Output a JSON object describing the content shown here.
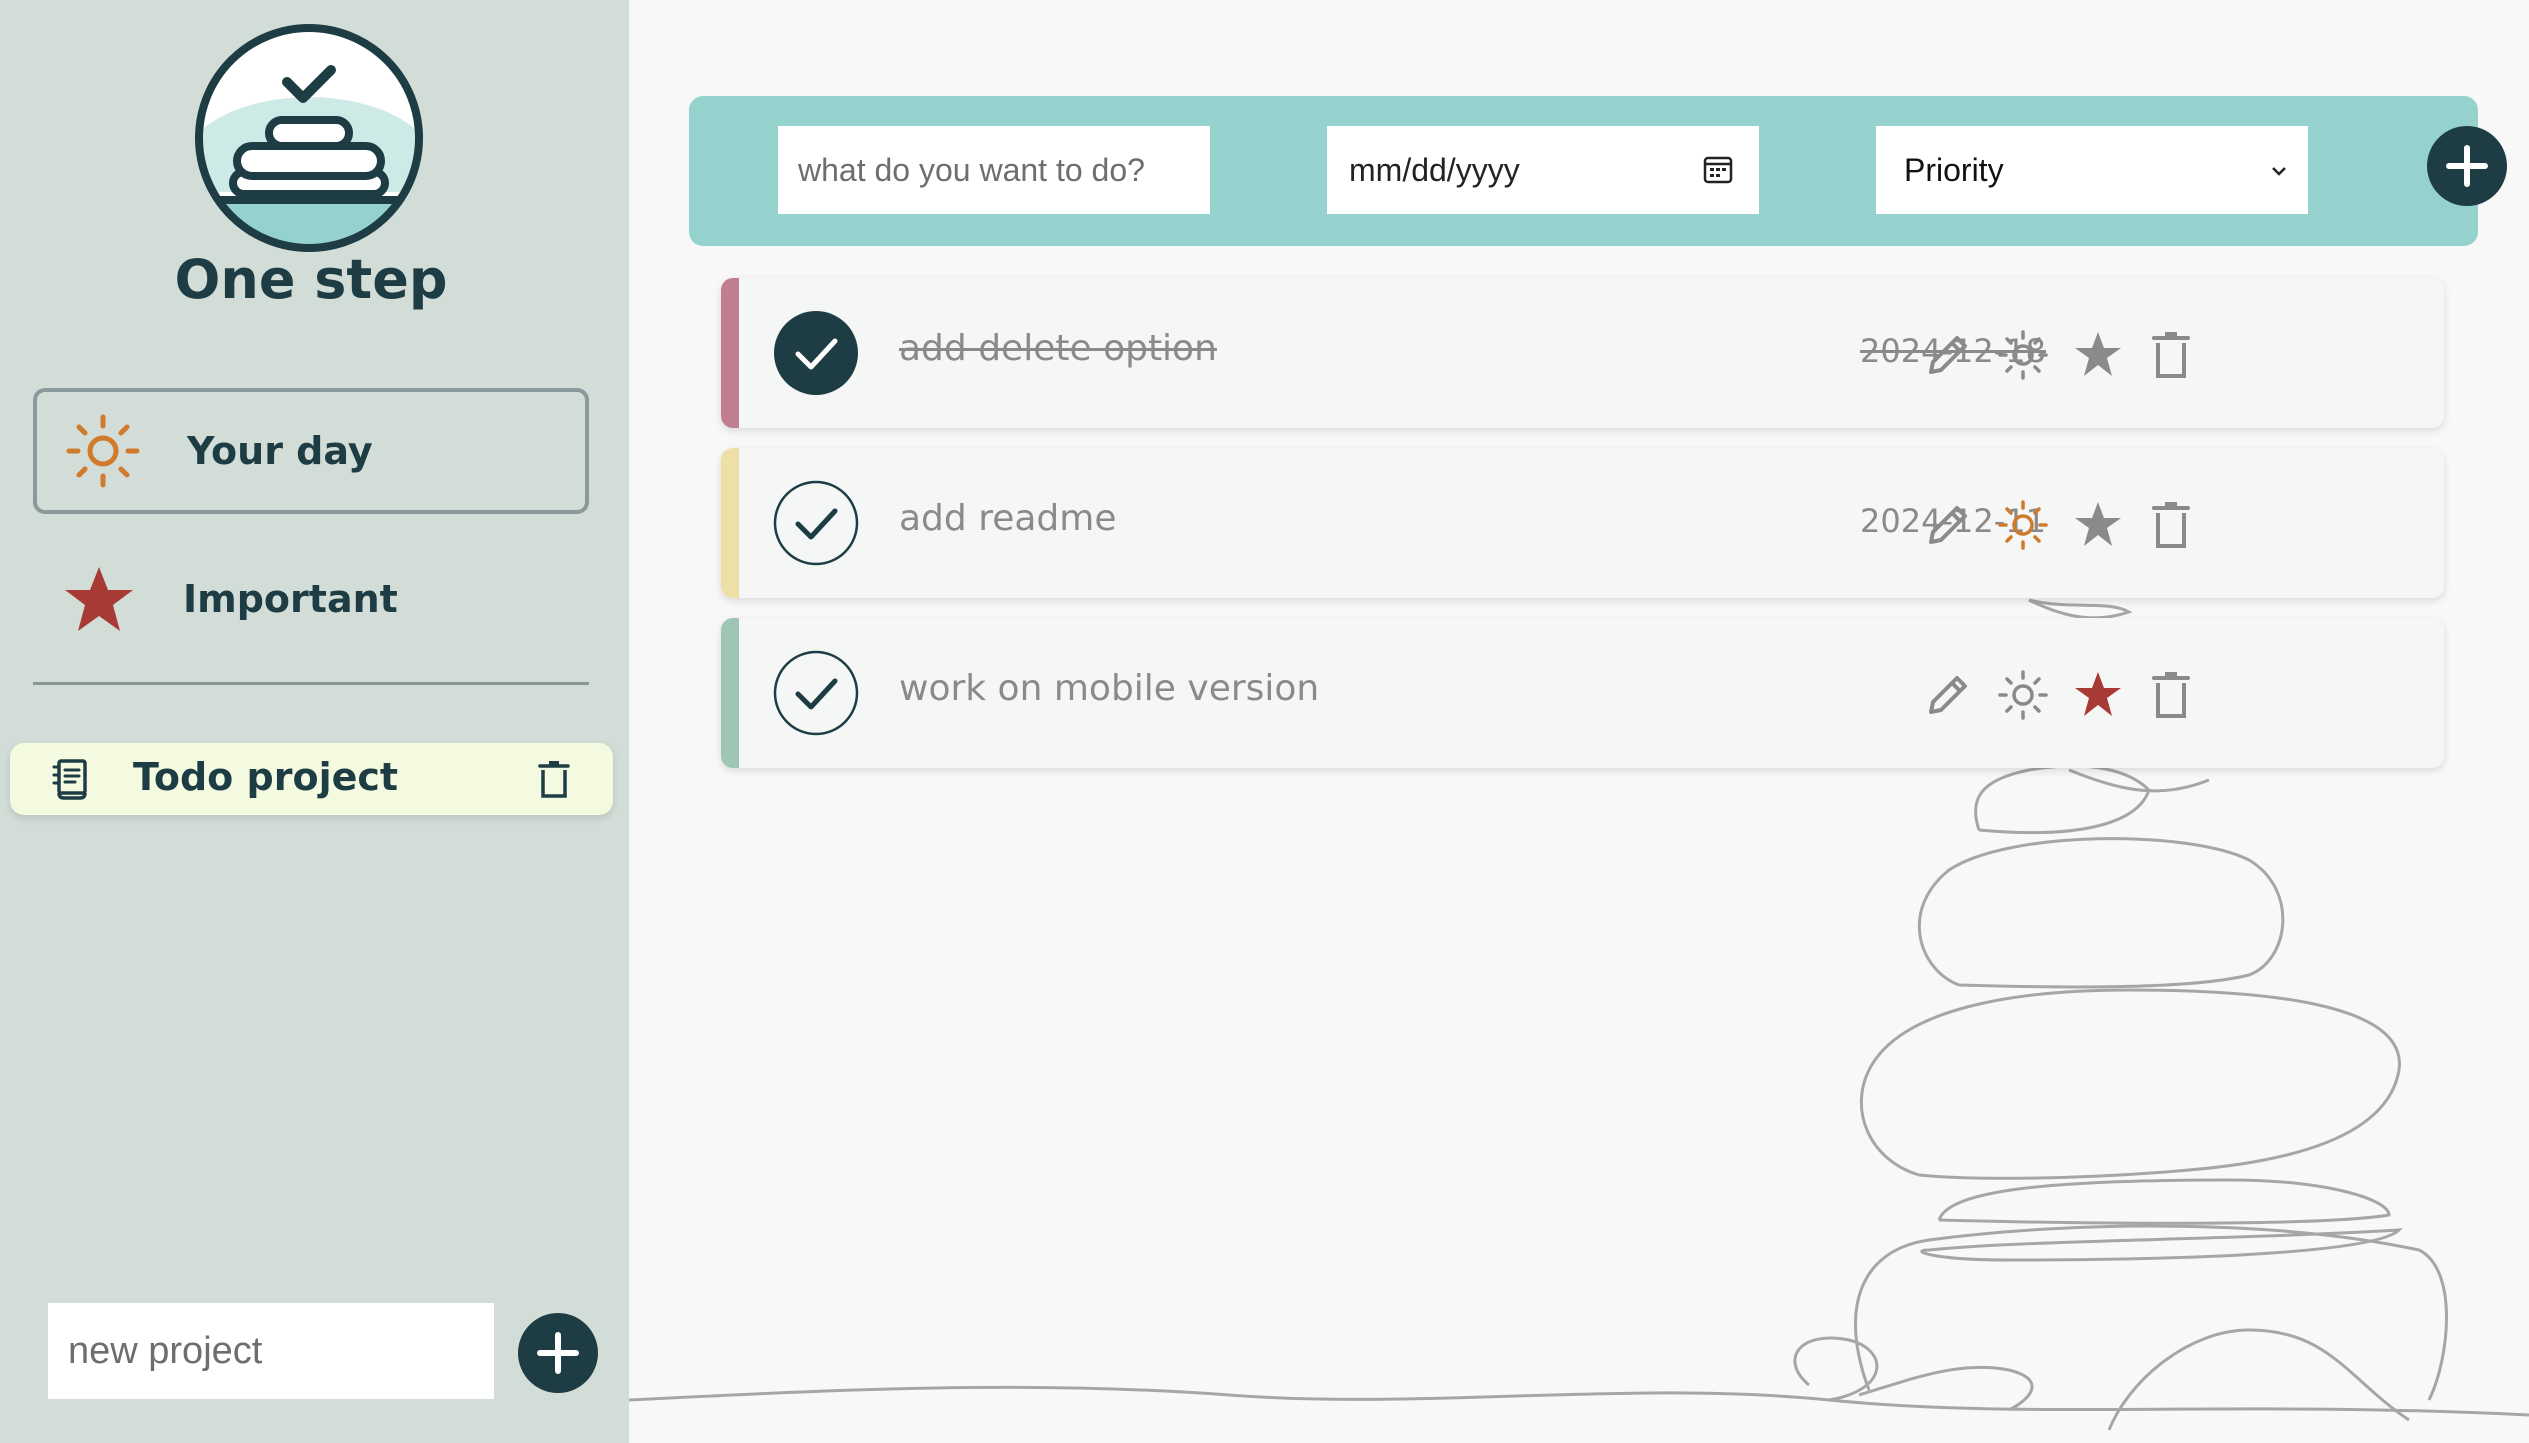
{
  "app": {
    "title": "One step"
  },
  "sidebar": {
    "nav": [
      {
        "label": "Your day",
        "icon": "sun-icon",
        "active": true
      },
      {
        "label": "Important",
        "icon": "star-icon",
        "active": false
      }
    ],
    "projects": [
      {
        "label": "Todo project",
        "icon": "notebook-icon"
      }
    ],
    "new_project": {
      "placeholder": "new project"
    }
  },
  "toolbar": {
    "task_placeholder": "what do you want to do?",
    "date_placeholder": "mm/dd/yyyy",
    "priority_label": "Priority"
  },
  "tasks": [
    {
      "title": "add delete option",
      "date": "2024-12-18",
      "completed": true,
      "priority_color": "#c07e8e",
      "my_day": false,
      "important": false
    },
    {
      "title": "add readme",
      "date": "2024-12-11",
      "completed": false,
      "priority_color": "#eedfa6",
      "my_day": true,
      "important": false
    },
    {
      "title": "work on mobile version",
      "date": "",
      "completed": false,
      "priority_color": "#9fc6b4",
      "my_day": false,
      "important": true
    }
  ],
  "colors": {
    "sidebar_bg": "#d3ddd8",
    "accent_dark": "#1e3c44",
    "toolbar_bg": "#95d2ce",
    "sun_orange": "#d07a2c",
    "star_red": "#a83a36",
    "icon_gray": "#8a8a8a",
    "project_bg": "#f4fae0"
  }
}
